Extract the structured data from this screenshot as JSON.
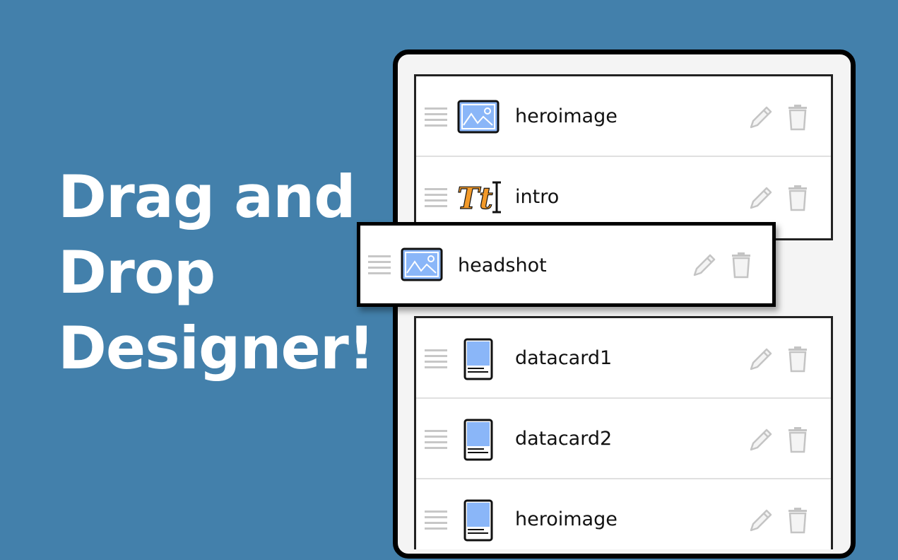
{
  "headline": {
    "line1": "Drag and",
    "line2": "Drop",
    "line3": "Designer!"
  },
  "colors": {
    "background": "#4380AB",
    "thumb_fill": "#8AB6F8",
    "text_icon_fill": "#F39A2A"
  },
  "components_top": [
    {
      "label": "heroimage",
      "icon": "image-icon"
    },
    {
      "label": "intro",
      "icon": "text-icon"
    }
  ],
  "dragging": {
    "label": "headshot",
    "icon": "image-icon"
  },
  "components_bottom": [
    {
      "label": "datacard1",
      "icon": "card-icon"
    },
    {
      "label": "datacard2",
      "icon": "card-icon"
    },
    {
      "label": "heroimage",
      "icon": "card-icon"
    }
  ],
  "text_icon": {
    "glyph": "Tt"
  },
  "action_icons": [
    "pencil-icon",
    "trash-icon"
  ]
}
